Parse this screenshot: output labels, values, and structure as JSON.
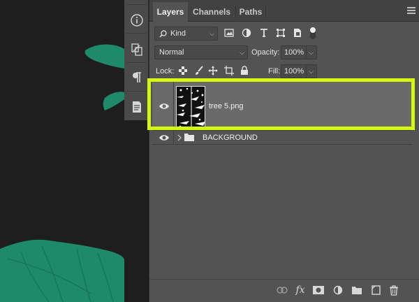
{
  "tabs": [
    {
      "label": "Layers",
      "active": true
    },
    {
      "label": "Channels",
      "active": false
    },
    {
      "label": "Paths",
      "active": false
    }
  ],
  "filter": {
    "kind_label": "Kind",
    "icons": [
      "pixel-filter-icon",
      "adjustment-filter-icon",
      "type-filter-icon",
      "shape-filter-icon",
      "smart-object-filter-icon",
      "filter-toggle-icon"
    ]
  },
  "blend": {
    "mode": "Normal",
    "opacity_label": "Opacity:",
    "opacity_value": "100%"
  },
  "lock": {
    "label": "Lock:",
    "icons": [
      "lock-transparent-icon",
      "lock-image-icon",
      "lock-position-icon",
      "lock-artboard-icon",
      "lock-all-icon"
    ],
    "fill_label": "Fill:",
    "fill_value": "100%"
  },
  "layers": [
    {
      "name": "tree 5.png",
      "visible": true,
      "selected": true,
      "type": "image"
    },
    {
      "name": "BACKGROUND",
      "visible": true,
      "selected": false,
      "type": "group"
    }
  ],
  "toolstrip_icons": [
    "info-icon",
    "clone-source-icon",
    "paragraph-icon",
    "notes-icon"
  ],
  "bottom_icons": [
    "link-layers-icon",
    "fx-icon",
    "add-mask-icon",
    "new-adjustment-layer-icon",
    "new-group-icon",
    "new-layer-icon",
    "trash-icon"
  ],
  "colors": {
    "highlight": "#d6f70f",
    "leaf": "#1e8a6a",
    "canvas": "#1e1e1e",
    "panel": "#535353"
  }
}
